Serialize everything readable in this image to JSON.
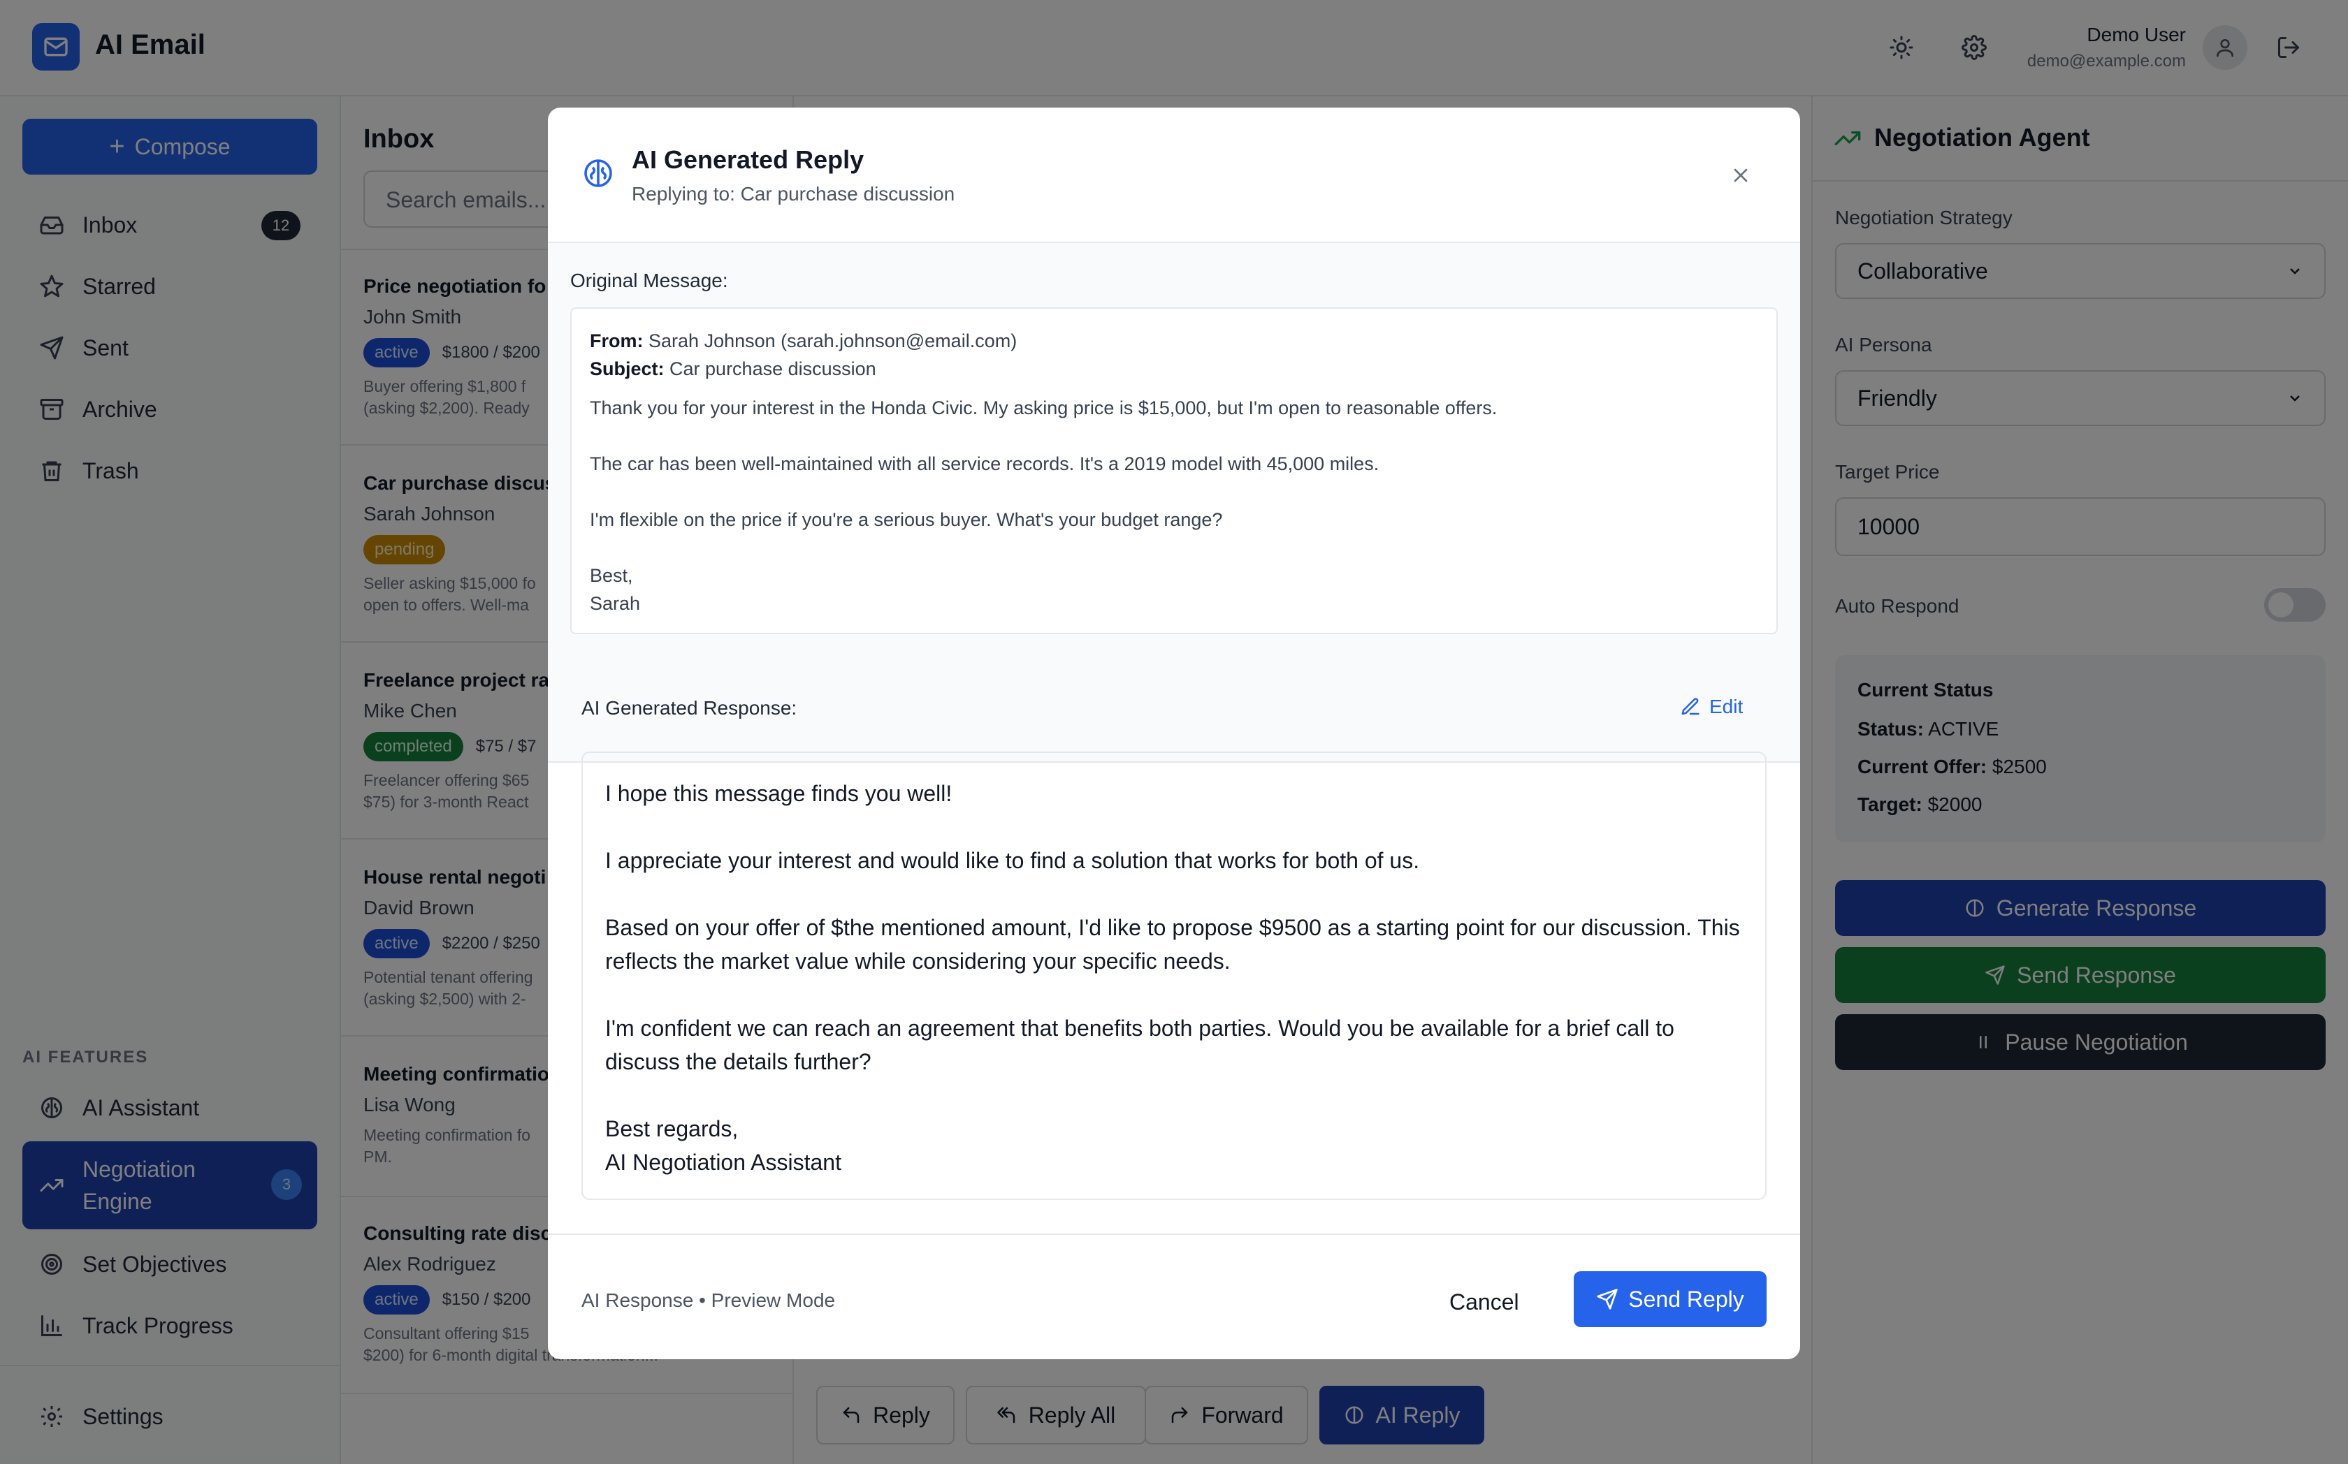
{
  "app": {
    "title": "AI Email"
  },
  "user": {
    "name": "Demo User",
    "email": "demo@example.com"
  },
  "sidebar": {
    "compose_label": "Compose",
    "items": [
      {
        "label": "Inbox",
        "icon": "inbox-icon",
        "badge": "12"
      },
      {
        "label": "Starred",
        "icon": "star-icon"
      },
      {
        "label": "Sent",
        "icon": "send-icon"
      },
      {
        "label": "Archive",
        "icon": "archive-icon"
      },
      {
        "label": "Trash",
        "icon": "trash-icon"
      }
    ],
    "ai_section_label": "AI FEATURES",
    "ai_items": [
      {
        "label": "AI Assistant",
        "icon": "brain-icon"
      },
      {
        "label": "Negotiation Engine",
        "icon": "trending-up-icon",
        "badge": "3"
      },
      {
        "label": "Set Objectives",
        "icon": "target-icon"
      },
      {
        "label": "Track Progress",
        "icon": "bar-chart-icon"
      }
    ],
    "settings_label": "Settings"
  },
  "inbox": {
    "title": "Inbox",
    "search_placeholder": "Search emails...",
    "emails": [
      {
        "subject": "Price negotiation fo",
        "sender": "John Smith",
        "status": "active",
        "price": "$1800 / $200",
        "preview1": "Buyer offering $1,800 f",
        "preview2": "(asking $2,200). Ready"
      },
      {
        "subject": "Car purchase discus",
        "sender": "Sarah Johnson",
        "status": "pending",
        "price": "",
        "preview1": "Seller asking $15,000 fo",
        "preview2": "open to offers. Well-ma"
      },
      {
        "subject": "Freelance project ra",
        "sender": "Mike Chen",
        "status": "completed",
        "price": "$75 / $7",
        "preview1": "Freelancer offering $65",
        "preview2": "$75) for 3-month React"
      },
      {
        "subject": "House rental negoti",
        "sender": "David Brown",
        "status": "active",
        "price": "$2200 / $250",
        "preview1": "Potential tenant offering",
        "preview2": "(asking $2,500) with 2-"
      },
      {
        "subject": "Meeting confirmatio",
        "sender": "Lisa Wong",
        "status": "",
        "price": "",
        "preview1": "Meeting confirmation fo",
        "preview2": "PM."
      },
      {
        "subject": "Consulting rate disc",
        "sender": "Alex Rodriguez",
        "status": "active",
        "price": "$150 / $200",
        "preview1": "Consultant offering $15",
        "preview2": "$200) for 6-month digital transformation..."
      }
    ]
  },
  "detail_actions": {
    "reply": "Reply",
    "reply_all": "Reply All",
    "forward": "Forward",
    "ai_reply": "AI Reply"
  },
  "negotiation": {
    "title": "Negotiation Agent",
    "strategy_label": "Negotiation Strategy",
    "strategy_value": "Collaborative",
    "persona_label": "AI Persona",
    "persona_value": "Friendly",
    "target_label": "Target Price",
    "target_value": "10000",
    "auto_label": "Auto Respond",
    "auto_on": false,
    "status_title": "Current Status",
    "status_key": "Status:",
    "status_value": "ACTIVE",
    "offer_key": "Current Offer:",
    "offer_value": "$2500",
    "target_key": "Target:",
    "target_status_value": "$2000",
    "generate_label": "Generate Response",
    "send_label": "Send Response",
    "pause_label": "Pause Negotiation"
  },
  "modal": {
    "title": "AI Generated Reply",
    "subtitle": "Replying to: Car purchase discussion",
    "original_label": "Original Message:",
    "from_key": "From:",
    "from_value": "Sarah Johnson (sarah.johnson@email.com)",
    "subject_key": "Subject:",
    "subject_value": "Car purchase discussion",
    "original_lines": [
      "Thank you for your interest in the Honda Civic. My asking price is $15,000, but I'm open to reasonable offers.",
      "The car has been well-maintained with all service records. It's a 2019 model with 45,000 miles.",
      "I'm flexible on the price if you're a serious buyer. What's your budget range?",
      "Best,",
      "Sarah"
    ],
    "response_label": "AI Generated Response:",
    "edit_label": "Edit",
    "response_text": "I hope this message finds you well!\n\nI appreciate your interest and would like to find a solution that works for both of us.\n\nBased on your offer of $the mentioned amount, I'd like to propose $9500 as a starting point for our discussion. This reflects the market value while considering your specific needs.\n\nI'm confident we can reach an agreement that benefits both parties. Would you be available for a brief call to discuss the details further?\n\nBest regards,\nAI Negotiation Assistant",
    "footer_note": "AI Response • Preview Mode",
    "cancel_label": "Cancel",
    "send_label": "Send Reply"
  },
  "colors": {
    "primary": "#2563eb",
    "primary_dark": "#1e40af",
    "success": "#15803d",
    "warning": "#ca8a04",
    "dark": "#1f2937"
  }
}
